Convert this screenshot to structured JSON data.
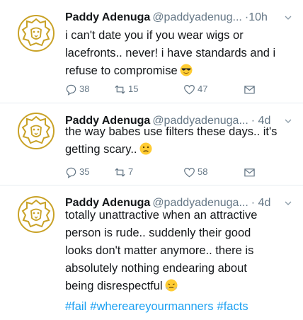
{
  "colors": {
    "text": "#14171a",
    "secondary": "#657786",
    "link": "#1da1f2",
    "avatar_gold": "#c9a227",
    "divider": "#e6ecf0"
  },
  "icons": {
    "reply": "reply-icon",
    "retweet": "retweet-icon",
    "like": "heart-icon",
    "dm": "envelope-icon",
    "more": "chevron-down-icon",
    "avatar": "lion-logo"
  },
  "tweets": [
    {
      "name": "Paddy Adenuga",
      "handle": "@paddyadenug...",
      "time": "·10h",
      "lines": [
        "i can't date you if you wear wigs or",
        "lacefronts.. never! i have standards and i",
        "refuse to compromise"
      ],
      "emoji": "sunglasses-face",
      "replies": "38",
      "retweets": "15",
      "likes": "47"
    },
    {
      "name": "Paddy Adenuga",
      "handle": "@paddyadenuga...",
      "time": "· 4d",
      "lines": [
        "the way babes use filters these days.. it's",
        "getting scary.."
      ],
      "emoji": "confused-face",
      "replies": "35",
      "retweets": "7",
      "likes": "58"
    },
    {
      "name": "Paddy Adenuga",
      "handle": "@paddyadenuga...",
      "time": "· 4d",
      "lines": [
        "totally unattractive when an attractive",
        "person is rude.. suddenly their good",
        "looks don't matter anymore.. there is",
        "absolutely nothing endearing about",
        "being disrespectful"
      ],
      "emoji": "steam-face",
      "hashtags": [
        "#fail",
        "#whereareyourmanners",
        "#facts"
      ]
    }
  ]
}
